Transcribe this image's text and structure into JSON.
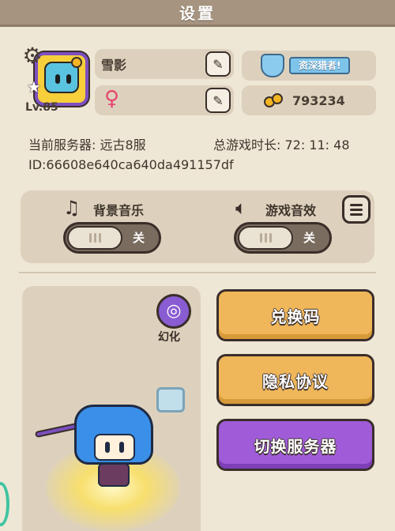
{
  "header": {
    "title": "设置"
  },
  "profile": {
    "level": "Lv.85",
    "name": "雪影",
    "gender_symbol": "♀",
    "rank_title": "资深猎者!",
    "currency": "793234",
    "server_line": "当前服务器:  远古8服",
    "playtime_line": "总游戏时长: 72: 11: 48",
    "id_line": "ID:66608e640ca640da491157df"
  },
  "audio": {
    "bgm_label": "背景音乐",
    "bgm_state": "关",
    "sfx_label": "游戏音效",
    "sfx_state": "关"
  },
  "character": {
    "morph_label": "幻化"
  },
  "actions": {
    "redeem_label": "兑换码",
    "privacy_label": "隐私协议",
    "switch_server_label": "切换服务器"
  },
  "colors": {
    "header_bg": "#a69480",
    "panel_bg": "#ddd1bd",
    "button_orange": "#f0b75a",
    "button_purple": "#a05cd8",
    "female_pink": "#e7466f"
  },
  "icons": [
    "gear-icon",
    "edit-icon",
    "shield-icon",
    "female-icon",
    "gold-icon",
    "music-note-icon",
    "speaker-icon",
    "menu-icon",
    "morph-icon"
  ]
}
